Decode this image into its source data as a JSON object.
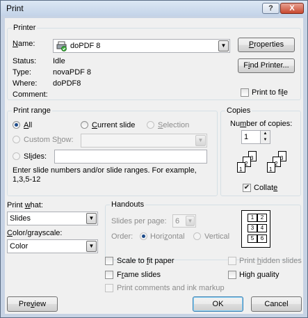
{
  "window": {
    "title": "Print",
    "help_glyph": "?",
    "close_glyph": "X"
  },
  "printer": {
    "group_label": "Printer",
    "name_label": "Name:",
    "name_value": "doPDF 8",
    "status_label": "Status:",
    "status_value": "Idle",
    "type_label": "Type:",
    "type_value": "novaPDF 8",
    "where_label": "Where:",
    "where_value": "doPDF8",
    "comment_label": "Comment:",
    "properties_button": "Properties",
    "find_printer_button": "Find Printer...",
    "print_to_file": "Print to file"
  },
  "print_range": {
    "group_label": "Print range",
    "all": "All",
    "current_slide": "Current slide",
    "selection": "Selection",
    "custom_show": "Custom Show:",
    "slides": "Slides:",
    "hint": "Enter slide numbers and/or slide ranges. For example, 1,3,5-12"
  },
  "copies": {
    "group_label": "Copies",
    "number_label": "Number of copies:",
    "number_value": "1",
    "collate": "Collate",
    "collate_checked": true,
    "set1_pages": [
      "1",
      "2",
      "3"
    ],
    "set2_pages": [
      "1",
      "2",
      "3"
    ]
  },
  "print_what": {
    "label": "Print what:",
    "value": "Slides"
  },
  "color": {
    "label": "Color/grayscale:",
    "value": "Color"
  },
  "handouts": {
    "group_label": "Handouts",
    "slides_per_page_label": "Slides per page:",
    "slides_per_page_value": "6",
    "order_label": "Order:",
    "horizontal": "Horizontal",
    "vertical": "Vertical",
    "preview_numbers": [
      "1",
      "2",
      "3",
      "4",
      "5",
      "6"
    ]
  },
  "options": {
    "scale_to_fit": "Scale to fit paper",
    "frame_slides": "Frame slides",
    "print_comments": "Print comments and ink markup",
    "print_hidden": "Print hidden slides",
    "high_quality": "High quality"
  },
  "footer": {
    "preview": "Preview",
    "ok": "OK",
    "cancel": "Cancel"
  }
}
